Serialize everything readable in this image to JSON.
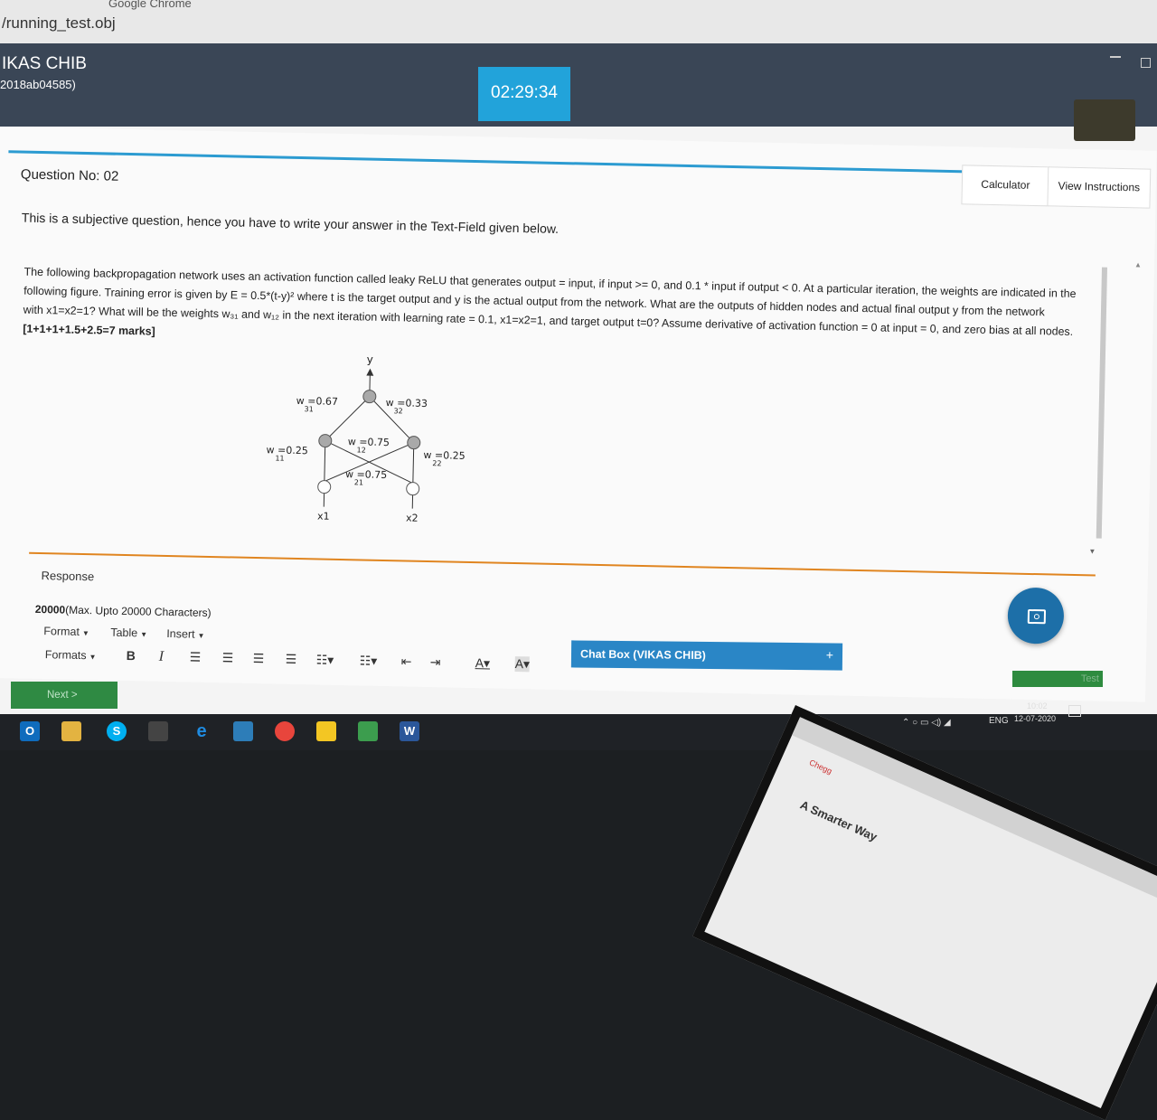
{
  "browser": {
    "title": "Google Chrome",
    "url": "/running_test.obj"
  },
  "header": {
    "candidate_name": "IKAS CHIB",
    "candidate_id": "2018ab04585)",
    "timer": "02:29:34"
  },
  "question": {
    "number_label": "Question No: 02",
    "calculator_label": "Calculator",
    "view_instructions_label": "View Instructions",
    "instruction": "This is a subjective question, hence you have to write your answer in the Text-Field given below.",
    "line1": "The following backpropagation network uses an activation function called leaky ReLU that generates output = input, if input >= 0, and 0.1 * input if output < 0.  At a particular iteration, the weights are indicated in the",
    "line2": "following figure.  Training error is given by E = 0.5*(t-y)² where t is the target output and y is the actual output from the network. What are the outputs of hidden nodes and actual final output y from the network",
    "line3": "with x1=x2=1? What will be the weights w₃₁ and w₁₂ in the next iteration with learning rate = 0.1, x1=x2=1, and target output t=0? Assume derivative of activation function = 0 at input = 0, and zero bias at all nodes.",
    "marks": "[1+1+1+1.5+2.5=7 marks]"
  },
  "diagram": {
    "output_label": "y",
    "w31": "w  =0.67",
    "w31_sub": "31",
    "w32": "w  =0.33",
    "w32_sub": "32",
    "w11": "w  =0.25",
    "w11_sub": "11",
    "w12": "w  =0.75",
    "w12_sub": "12",
    "w21": "w  =0.75",
    "w21_sub": "21",
    "w22": "w  =0.25",
    "w22_sub": "22",
    "x1": "x1",
    "x2": "x2"
  },
  "response": {
    "label": "Response",
    "char_limit": "20000",
    "char_limit_note": "(Max. Upto 20000 Characters)",
    "menu_format": "Format",
    "menu_table": "Table",
    "menu_insert": "Insert",
    "formats": "Formats",
    "bold": "B",
    "italic": "I"
  },
  "chat": {
    "label": "Chat Box (VIKAS CHIB)",
    "plus": "+"
  },
  "footer": {
    "test_button": "Test",
    "next_button": "Next >"
  },
  "taskbar": {
    "lang": "ENG",
    "time": "10:02",
    "date": "12-07-2020"
  },
  "laptop": {
    "text": "A Smarter Way",
    "tab": "Chegg"
  },
  "colors": {
    "header_bg": "#3a4656",
    "timer_bg": "#22a3da",
    "accent_blue": "#2c9bd1",
    "orange_rule": "#e08520",
    "chat_bg": "#2a86c6",
    "next_bg": "#2f8a43"
  }
}
